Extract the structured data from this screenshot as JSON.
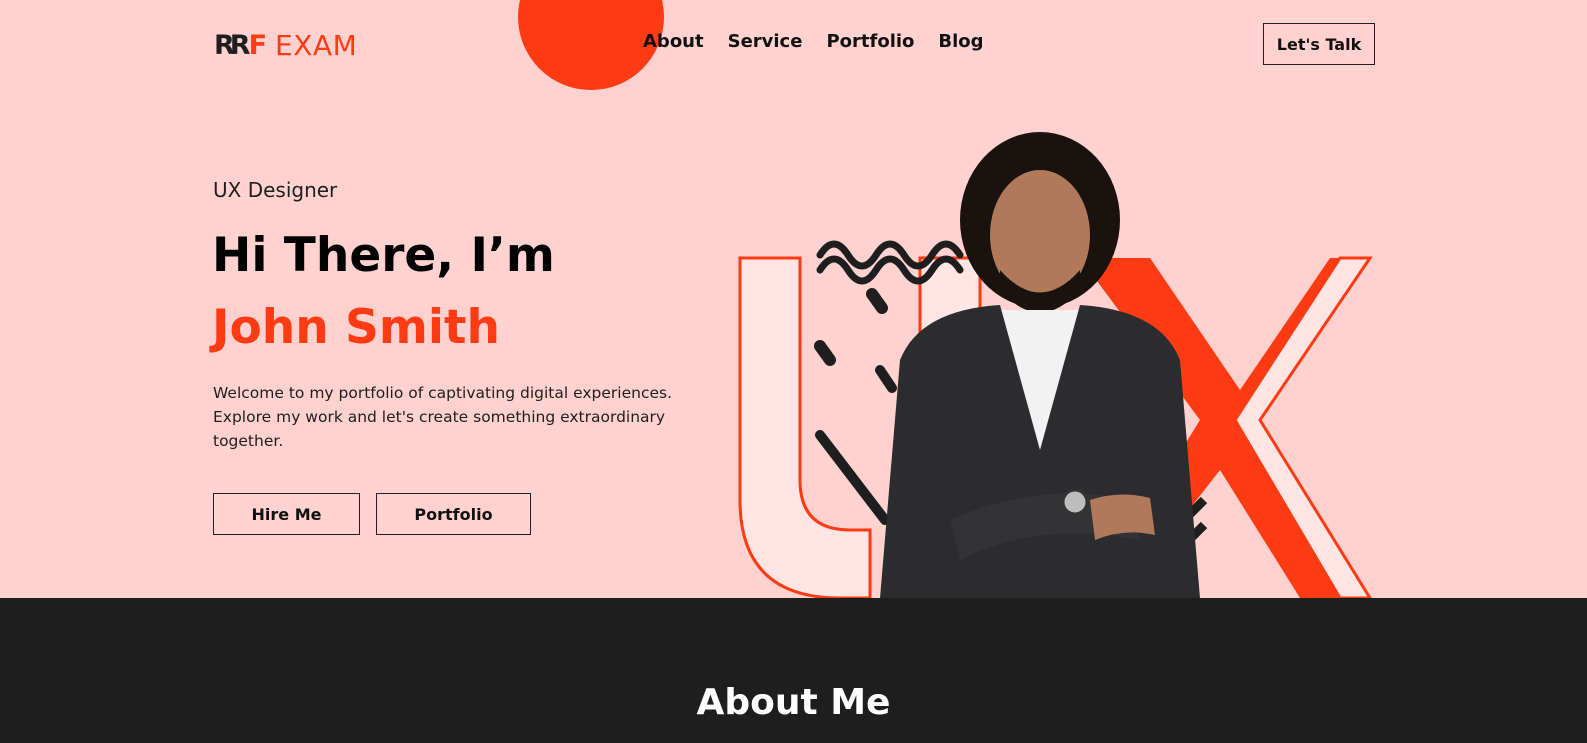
{
  "header": {
    "logo_mark": "RR",
    "logo_f": "F",
    "logo_text": "EXAM",
    "nav": [
      {
        "label": "About"
      },
      {
        "label": "Service"
      },
      {
        "label": "Portfolio"
      },
      {
        "label": "Blog"
      }
    ],
    "cta_label": "Let's Talk"
  },
  "hero": {
    "role": "UX Designer",
    "greeting": "Hi There, I’m",
    "name": "John Smith",
    "intro": "Welcome to my portfolio of captivating digital experiences. Explore my work and let's create something extraordinary together.",
    "hire_label": "Hire Me",
    "portfolio_label": "Portfolio",
    "art_icon": "person-with-ux-letters-illustration"
  },
  "about": {
    "title": "About Me"
  },
  "colors": {
    "accent": "#ff3b14",
    "hero_bg": "#ffd2cf",
    "dark_bg": "#1e1e1e",
    "text_dark": "#111111"
  }
}
